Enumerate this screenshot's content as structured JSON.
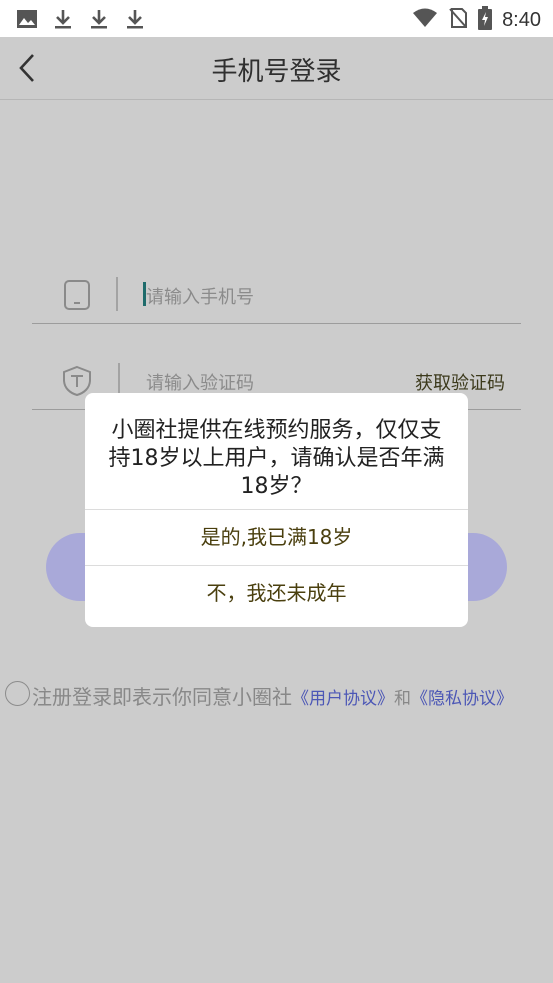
{
  "status_bar": {
    "time": "8:40",
    "left_icons": [
      "image-icon",
      "download-icon",
      "download-icon",
      "download-icon"
    ],
    "right_icons": [
      "wifi-icon",
      "no-sim-icon",
      "battery-charging-icon"
    ]
  },
  "header": {
    "back_icon": "chevron-left-icon",
    "title": "手机号登录"
  },
  "form": {
    "phone_icon": "phone-icon",
    "phone_placeholder": "请输入手机号",
    "code_icon": "shield-icon",
    "code_placeholder": "请输入验证码",
    "get_code_label": "获取验证码"
  },
  "agreement": {
    "prefix": "注册登录即表示你同意小圈社",
    "user_agreement": "《用户协议》",
    "and": "和",
    "privacy_agreement": "《隐私协议》"
  },
  "dialog": {
    "message": "小圈社提供在线预约服务，仅仅支持18岁以上用户，请确认是否年满18岁？",
    "confirm_label": "是的,我已满18岁",
    "deny_label": "不，我还未成年"
  },
  "colors": {
    "background": "#cccccc",
    "login_button": "#a9a9d9",
    "link": "#4c57b6",
    "dialog_option": "#4a3f0e"
  }
}
